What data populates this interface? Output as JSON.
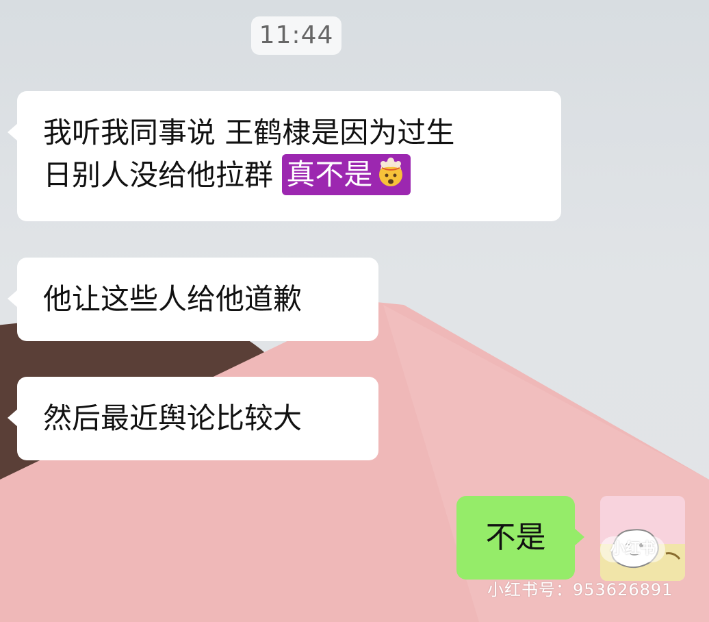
{
  "chat": {
    "timestamp": "11:44",
    "incoming": [
      {
        "line1": "我听我同事说 王鹤棣是因为过生",
        "line2": "日别人没给他拉群",
        "highlight": "真不是"
      },
      {
        "text": "他让这些人给他道歉"
      },
      {
        "text": "然后最近舆论比较大"
      }
    ],
    "outgoing": [
      {
        "text": "不是"
      }
    ]
  },
  "watermark": {
    "logo": "小红书",
    "id_text": "小红书号：953626891"
  },
  "icons": {
    "highlight_emoji": "exploding-head-icon",
    "avatar": "avatar-image"
  },
  "colors": {
    "highlight_bg": "#9c27b0",
    "outgoing_bubble": "#95ec69",
    "incoming_bubble": "#ffffff"
  }
}
